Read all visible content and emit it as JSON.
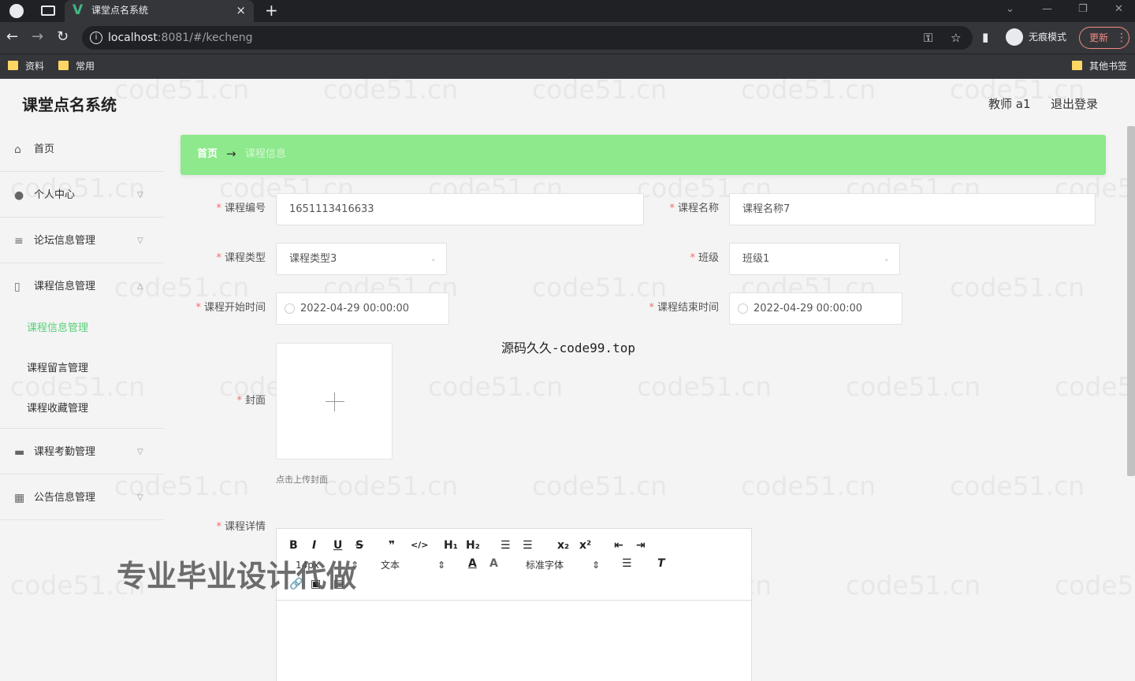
{
  "browser": {
    "tab_title": "课堂点名系统",
    "tab_logo": "V",
    "url_host": "localhost",
    "url_rest": ":8081/#/kecheng",
    "incognito_label": "无痕模式",
    "update_label": "更新",
    "bookmarks": [
      "资料",
      "常用"
    ],
    "other_bookmarks": "其他书签"
  },
  "app": {
    "title": "课堂点名系统",
    "user_label": "教师 a1",
    "logout_label": "退出登录"
  },
  "sidebar": {
    "items": [
      {
        "label": "首页",
        "icon": "home-icon"
      },
      {
        "label": "个人中心",
        "icon": "user-icon"
      },
      {
        "label": "论坛信息管理",
        "icon": "list-icon"
      },
      {
        "label": "课程信息管理",
        "icon": "document-icon"
      },
      {
        "label": "课程考勤管理",
        "icon": "briefcase-icon"
      },
      {
        "label": "公告信息管理",
        "icon": "grid-icon"
      }
    ],
    "sub_items": [
      "课程信息管理",
      "课程留言管理",
      "课程收藏管理"
    ]
  },
  "breadcrumb": {
    "home": "首页",
    "arrow": "→",
    "current": "课程信息"
  },
  "form": {
    "course_no_label": "课程编号",
    "course_no_value": "1651113416633",
    "course_name_label": "课程名称",
    "course_name_value": "课程名称7",
    "course_type_label": "课程类型",
    "course_type_value": "课程类型3",
    "class_label": "班级",
    "class_value": "班级1",
    "start_time_label": "课程开始时间",
    "start_time_value": "2022-04-29 00:00:00",
    "end_time_label": "课程结束时间",
    "end_time_value": "2022-04-29 00:00:00",
    "cover_label": "封面",
    "cover_hint": "点击上传封面",
    "detail_label": "课程详情",
    "required_mark": "*"
  },
  "editor": {
    "font_size": "14px",
    "paragraph": "文本",
    "font_family": "标准字体"
  },
  "overlay": {
    "center_text": "源码久久-code99.top",
    "promo_text": "专业毕业设计代做",
    "watermark": "code51.cn"
  },
  "colors": {
    "breadcrumb_bg": "#8de98b",
    "active_menu": "#5ad07a",
    "required": "#f56c6c"
  }
}
